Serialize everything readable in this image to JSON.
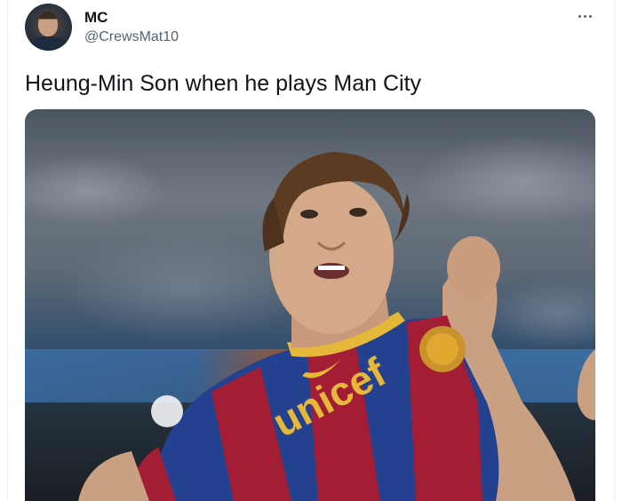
{
  "user": {
    "display_name": "MC",
    "handle": "@CrewsMat10"
  },
  "tweet": {
    "text": "Heung-Min Son when he plays Man City"
  },
  "media": {
    "shirt_text": "unicef"
  },
  "icons": {
    "more": "more-horizontal-icon"
  },
  "colors": {
    "text_primary": "#0f1419",
    "text_secondary": "#536471",
    "shirt_red": "#a31d34",
    "shirt_blue": "#24418f",
    "shirt_gold": "#e6b83a"
  }
}
